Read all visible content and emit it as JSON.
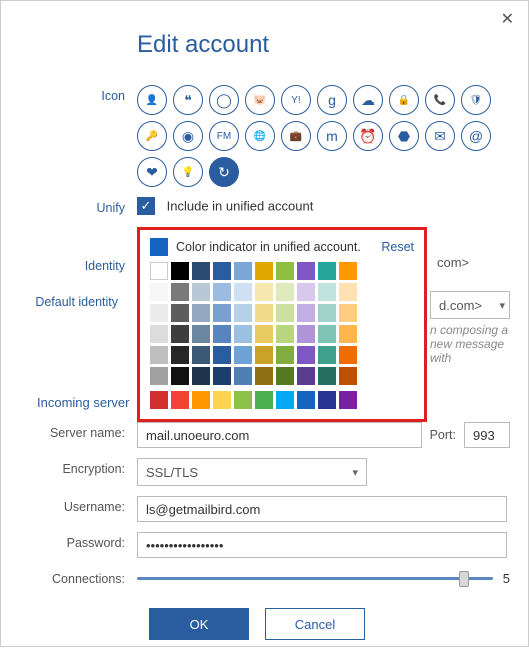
{
  "window": {
    "title": "Edit account"
  },
  "labels": {
    "icon": "Icon",
    "unify": "Unify",
    "identity": "Identity",
    "default_identity": "Default identity",
    "incoming_server": "Incoming server",
    "server_name": "Server name:",
    "port": "Port:",
    "encryption": "Encryption:",
    "username": "Username:",
    "password": "Password:",
    "connections": "Connections:"
  },
  "icons": [
    "user-icon",
    "quotes-icon",
    "circle-o-icon",
    "piggy-icon",
    "yahoo-icon",
    "google-icon",
    "cloud-icon",
    "lock-icon",
    "phone-icon",
    "shield-icon",
    "key-icon",
    "at-swirl-icon",
    "fm-icon",
    "globe-icon",
    "briefcase-icon",
    "m-icon",
    "clock-icon",
    "cube-icon",
    "outlook-icon",
    "at-icon",
    "heart-icon",
    "bulb-icon",
    "refresh-icon"
  ],
  "icon_selected_index": 22,
  "unify": {
    "include_label": "Include in unified account",
    "include_checked": true
  },
  "popover": {
    "title": "Color indicator in unified account.",
    "reset": "Reset",
    "current_color": "#1565c0",
    "palette_rows": [
      [
        "#ffffff",
        "#000000",
        "#2a4b6f",
        "#2a5da0",
        "#7aa7d6",
        "#e0a800",
        "#8fbf3f",
        "#7e57c2",
        "#26a69a",
        "#ff9800"
      ],
      [
        "#f6f6f6",
        "#7a7a7a",
        "#b9c7d6",
        "#9bbbe0",
        "#cfe0f3",
        "#f6e7b0",
        "#dfeabf",
        "#d7c8ec",
        "#bfe3dd",
        "#ffe0b2"
      ],
      [
        "#ececec",
        "#5d5d5d",
        "#93a9c0",
        "#7aa0cf",
        "#b6d0ea",
        "#efd98a",
        "#cde09f",
        "#c3aee3",
        "#9fd3c9",
        "#ffcc80"
      ],
      [
        "#dcdcdc",
        "#3e3e3e",
        "#6b879f",
        "#5885bd",
        "#9cc0e1",
        "#e8cb63",
        "#bad57f",
        "#af94da",
        "#7fc3b5",
        "#ffb74d"
      ],
      [
        "#bfbfbf",
        "#262626",
        "#3b5876",
        "#2a5da0",
        "#6fa3d6",
        "#c9a227",
        "#7fae3f",
        "#7e57c2",
        "#3fa18d",
        "#ef6c00"
      ],
      [
        "#a0a0a0",
        "#111111",
        "#1e344c",
        "#1b3e6b",
        "#4f7fb3",
        "#8f6f14",
        "#567a24",
        "#5a3d91",
        "#276f60",
        "#bf4f00"
      ]
    ],
    "palette_bottom": [
      "#d32f2f",
      "#f44336",
      "#ff9800",
      "#ffd54f",
      "#8bc34a",
      "#4caf50",
      "#03a9f4",
      "#1565c0",
      "#283593",
      "#7b1fa2"
    ]
  },
  "identity": {
    "behind_text_1": "com>",
    "default_value": "d.com>",
    "hint_partial": "n composing a new message with"
  },
  "server": {
    "name": "mail.unoeuro.com",
    "port": "993",
    "encryption": "SSL/TLS",
    "username": "ls@getmailbird.com",
    "password_mask": "•••••••••••••••••",
    "connections": "5",
    "connections_pct": 92
  },
  "buttons": {
    "ok": "OK",
    "cancel": "Cancel"
  }
}
